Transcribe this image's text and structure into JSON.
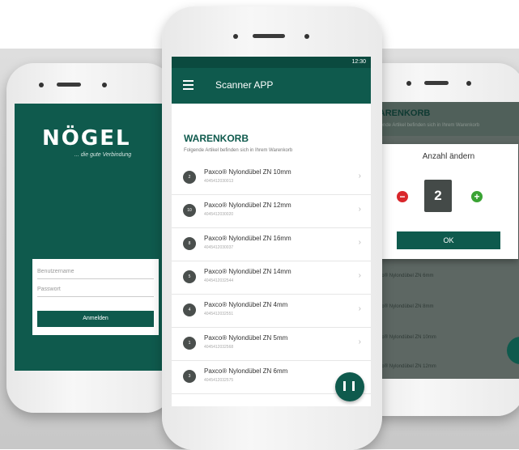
{
  "left_phone": {
    "logo": "NÖGEL",
    "tagline": "... die gute Verbindung",
    "login": {
      "username_placeholder": "Benutzername",
      "password_placeholder": "Passwort",
      "button": "Anmelden"
    }
  },
  "center_phone": {
    "status_time": "12:30",
    "app_title": "Scanner APP",
    "cart_title": "WARENKORB",
    "cart_subtitle": "Folgende Artikel befinden sich in Ihrem Warenkorb",
    "items": [
      {
        "qty": "2",
        "name": "Paxco® Nylondübel ZN 10mm",
        "code": "4045412030013"
      },
      {
        "qty": "10",
        "name": "Paxco® Nylondübel ZN 12mm",
        "code": "4045412030020"
      },
      {
        "qty": "8",
        "name": "Paxco® Nylondübel ZN 16mm",
        "code": "4045412030037"
      },
      {
        "qty": "5",
        "name": "Paxco® Nylondübel ZN 14mm",
        "code": "4045412032544"
      },
      {
        "qty": "4",
        "name": "Paxco® Nylondübel ZN 4mm",
        "code": "4045412032551"
      },
      {
        "qty": "1",
        "name": "Paxco® Nylondübel ZN 5mm",
        "code": "4045412032568"
      },
      {
        "qty": "3",
        "name": "Paxco® Nylondübel ZN 6mm",
        "code": "4045412032575"
      }
    ]
  },
  "right_phone": {
    "header_title": "WARENKORB",
    "header_sub": "Folgende Artikel befinden sich in Ihrem Warenkorb",
    "dialog": {
      "title": "Anzahl ändern",
      "value": "2",
      "ok": "OK"
    },
    "rows": [
      "Paxco® Nylondübel ZN 6mm",
      "Paxco® Nylondübel ZN 8mm",
      "Paxco® Nylondübel ZN 10mm",
      "Paxco® Nylondübel ZN 12mm"
    ]
  },
  "colors": {
    "brand_green": "#0f5a4d",
    "minus_red": "#d9262b",
    "plus_green": "#3aa334"
  }
}
